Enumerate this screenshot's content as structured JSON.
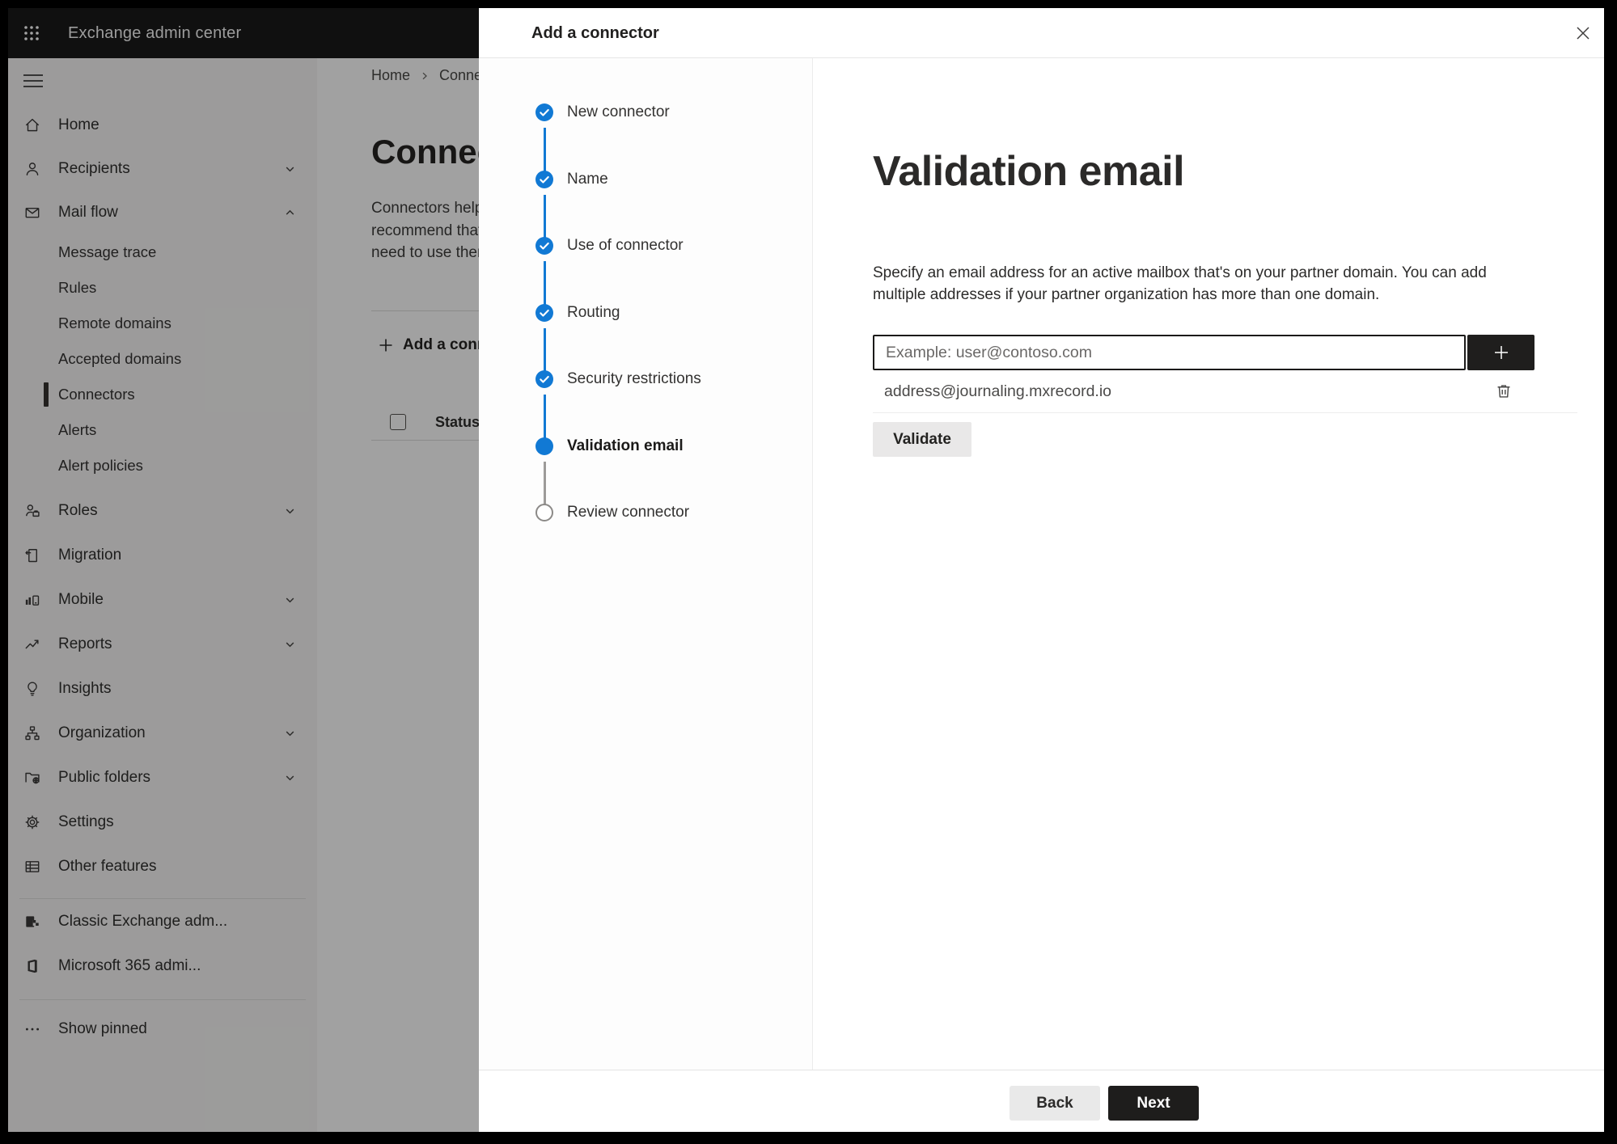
{
  "app": {
    "title": "Exchange admin center"
  },
  "colors": {
    "accent_blue": "#1179d4",
    "topbar_bg": "#191919",
    "dark_button_bg": "#1f1e1d",
    "light_button_bg": "#e9e8e8",
    "sidebar_bg": "#f3f2f1"
  },
  "sidebar": {
    "items": [
      {
        "label": "Home",
        "icon": "home-icon",
        "level": "top"
      },
      {
        "label": "Recipients",
        "icon": "person-icon",
        "level": "top",
        "chevron": "down"
      },
      {
        "label": "Mail flow",
        "icon": "mail-icon",
        "level": "top",
        "chevron": "up",
        "expanded": true
      },
      {
        "label": "Message trace",
        "level": "sub"
      },
      {
        "label": "Rules",
        "level": "sub"
      },
      {
        "label": "Remote domains",
        "level": "sub"
      },
      {
        "label": "Accepted domains",
        "level": "sub"
      },
      {
        "label": "Connectors",
        "level": "sub",
        "selected": true
      },
      {
        "label": "Alerts",
        "level": "sub"
      },
      {
        "label": "Alert policies",
        "level": "sub"
      },
      {
        "label": "Roles",
        "icon": "roles-icon",
        "level": "top",
        "chevron": "down"
      },
      {
        "label": "Migration",
        "icon": "migration-icon",
        "level": "top"
      },
      {
        "label": "Mobile",
        "icon": "mobile-icon",
        "level": "top",
        "chevron": "down"
      },
      {
        "label": "Reports",
        "icon": "reports-icon",
        "level": "top",
        "chevron": "down"
      },
      {
        "label": "Insights",
        "icon": "lightbulb-icon",
        "level": "top"
      },
      {
        "label": "Organization",
        "icon": "org-chart-icon",
        "level": "top",
        "chevron": "down"
      },
      {
        "label": "Public folders",
        "icon": "folder-globe-icon",
        "level": "top",
        "chevron": "down"
      },
      {
        "label": "Settings",
        "icon": "gear-icon",
        "level": "top"
      },
      {
        "label": "Other features",
        "icon": "table-icon",
        "level": "top"
      },
      {
        "label": "Classic Exchange adm...",
        "icon": "exchange-logo-icon",
        "level": "top"
      },
      {
        "label": "Microsoft 365 admi...",
        "icon": "m365-logo-icon",
        "level": "top"
      },
      {
        "label": "Show pinned",
        "icon": "ellipsis-icon",
        "level": "top"
      }
    ]
  },
  "background": {
    "breadcrumb": {
      "home": "Home",
      "current": "Conne"
    },
    "page_title": "Connect",
    "paragraph_lines": [
      "Connectors help",
      "recommend that",
      "need to use ther"
    ],
    "add_connector_button": "Add a conn",
    "table": {
      "status_header": "Status"
    }
  },
  "dialog": {
    "title": "Add a connector",
    "steps": [
      {
        "label": "New connector",
        "state": "completed"
      },
      {
        "label": "Name",
        "state": "completed"
      },
      {
        "label": "Use of connector",
        "state": "completed"
      },
      {
        "label": "Routing",
        "state": "completed"
      },
      {
        "label": "Security restrictions",
        "state": "completed"
      },
      {
        "label": "Validation email",
        "state": "current"
      },
      {
        "label": "Review connector",
        "state": "pending"
      }
    ],
    "content": {
      "heading": "Validation email",
      "description_line1": "Specify an email address for an active mailbox that's on your partner domain. You can add",
      "description_line2": "multiple addresses if your partner organization has more than one domain.",
      "email_input_placeholder": "Example: user@contoso.com",
      "added_address": "address@journaling.mxrecord.io",
      "validate_button": "Validate"
    },
    "footer": {
      "back_button": "Back",
      "next_button": "Next"
    }
  }
}
